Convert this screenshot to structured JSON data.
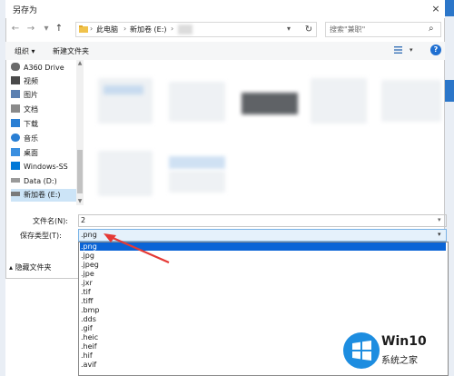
{
  "dialog": {
    "title": "另存为",
    "close_glyph": "×"
  },
  "address": {
    "crumbs": [
      "此电脑",
      "新加卷 (E:)"
    ],
    "separator": "›"
  },
  "search": {
    "placeholder": "搜索\"兼职\""
  },
  "toolbar": {
    "organize": "组织 ▾",
    "new_folder": "新建文件夹",
    "help_label": "?"
  },
  "nav_pane": {
    "items": [
      {
        "label": "A360 Drive",
        "icon": "cloud-icon"
      },
      {
        "label": "视频",
        "icon": "video-icon"
      },
      {
        "label": "图片",
        "icon": "pictures-icon"
      },
      {
        "label": "文档",
        "icon": "documents-icon"
      },
      {
        "label": "下载",
        "icon": "download-icon"
      },
      {
        "label": "音乐",
        "icon": "music-icon"
      },
      {
        "label": "桌面",
        "icon": "desktop-icon"
      },
      {
        "label": "Windows-SS",
        "icon": "drive-icon"
      },
      {
        "label": "Data (D:)",
        "icon": "drive-icon"
      },
      {
        "label": "新加卷 (E:)",
        "icon": "drive-icon",
        "selected": true
      }
    ]
  },
  "form": {
    "filename_label": "文件名(N):",
    "filename_value": "2",
    "filetype_label": "保存类型(T):",
    "filetype_value": ".png",
    "hide_folders": "隐藏文件夹"
  },
  "filetype_options": [
    ".png",
    ".jpg",
    ".jpeg",
    ".jpe",
    ".jxr",
    ".tif",
    ".tiff",
    ".bmp",
    ".dds",
    ".gif",
    ".heic",
    ".heif",
    ".hif",
    ".avif"
  ],
  "selected_option_index": 0,
  "watermark": {
    "line1": "Win10",
    "line2": "系统之家"
  },
  "colors": {
    "accent": "#0a64d6",
    "arrow": "#e53935",
    "help_blue": "#1f6fd1"
  }
}
